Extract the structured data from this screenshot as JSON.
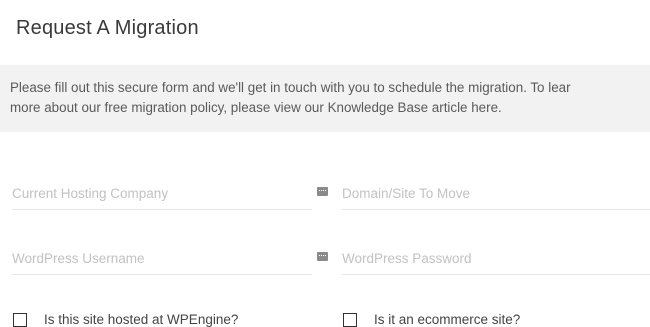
{
  "title": "Request A Migration",
  "notice": {
    "line1": "Please fill out this secure form and we'll get in touch with you to schedule the migration. To lear",
    "line2": "more about our free migration policy, please view our Knowledge Base article here."
  },
  "fields": {
    "hosting_company": {
      "placeholder": "Current Hosting Company",
      "value": ""
    },
    "domain": {
      "placeholder": "Domain/Site To Move",
      "value": ""
    },
    "wp_username": {
      "placeholder": "WordPress Username",
      "value": ""
    },
    "wp_password": {
      "placeholder": "WordPress Password",
      "value": ""
    }
  },
  "icons": {
    "field_icon": "keyboard-icon"
  },
  "checkboxes": {
    "wpengine": {
      "label": "Is this site hosted at WPEngine?",
      "checked": false
    },
    "ecommerce": {
      "label": "Is it an ecommerce site?",
      "checked": false
    }
  }
}
